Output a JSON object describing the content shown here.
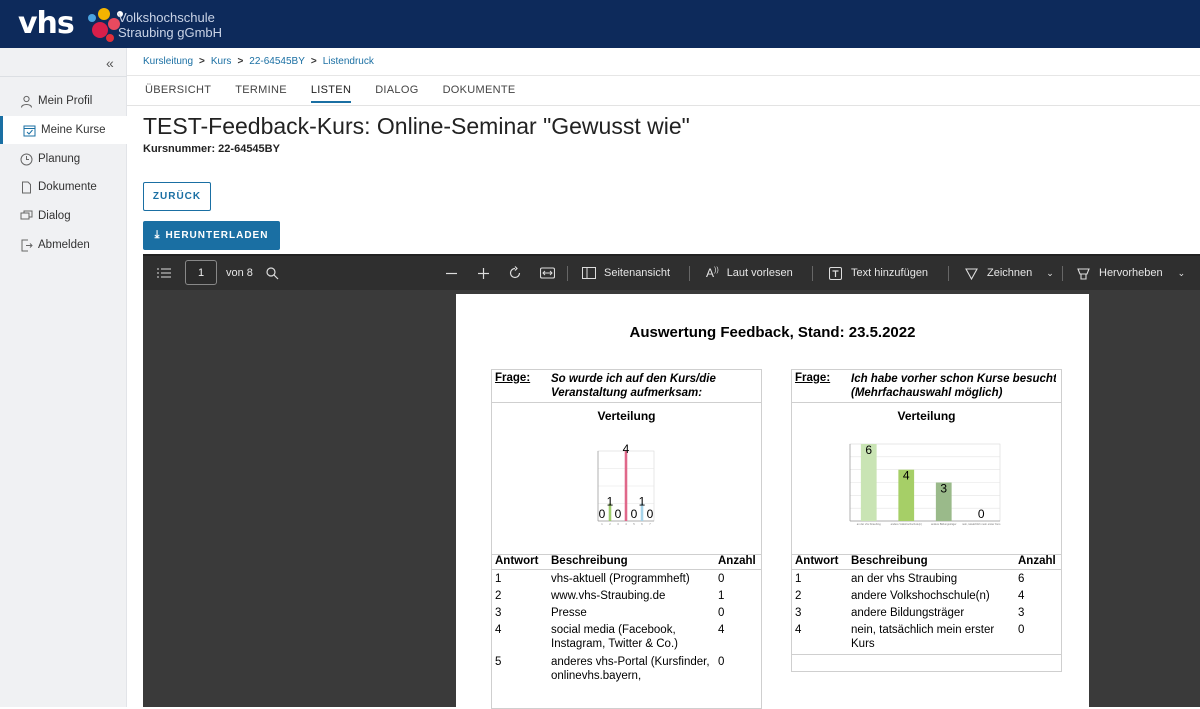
{
  "header": {
    "logo_text": "vhs",
    "brand_line1": "Volkshochschule",
    "brand_line2": "Straubing gGmbH"
  },
  "sidebar": {
    "items": [
      {
        "label": "Mein Profil",
        "icon": "person-icon"
      },
      {
        "label": "Meine Kurse",
        "icon": "calendar-check-icon",
        "active": true
      },
      {
        "label": "Planung",
        "icon": "clock-icon"
      },
      {
        "label": "Dokumente",
        "icon": "document-icon"
      },
      {
        "label": "Dialog",
        "icon": "chat-icon"
      },
      {
        "label": "Abmelden",
        "icon": "logout-icon"
      }
    ]
  },
  "breadcrumb": [
    "Kursleitung",
    "Kurs",
    "22-64545BY",
    "Listendruck"
  ],
  "tabs": [
    "ÜBERSICHT",
    "TERMINE",
    "LISTEN",
    "DIALOG",
    "DOKUMENTE"
  ],
  "page": {
    "title": "TEST-Feedback-Kurs: Online-Seminar \"Gewusst wie\"",
    "kursnummer": "Kursnummer: 22-64545BY",
    "back_label": "ZURÜCK",
    "download_label": "HERUNTERLADEN"
  },
  "viewer": {
    "page_number": "1",
    "page_count": "von 8",
    "seitenansicht": "Seitenansicht",
    "laut_vorlesen": "Laut vorlesen",
    "text_hinzufuegen": "Text hinzufügen",
    "zeichnen": "Zeichnen",
    "hervorheben": "Hervorheben"
  },
  "pdf": {
    "title": "Auswertung Feedback, Stand: 23.5.2022",
    "frage_label": "Frage:",
    "verteilung": "Verteilung",
    "col_antwort": "Antwort",
    "col_beschreibung": "Beschreibung",
    "col_anzahl": "Anzahl",
    "q1": {
      "text_line1": "So wurde ich auf den Kurs/die",
      "text_line2": "Veranstaltung aufmerksam:",
      "rows": [
        {
          "nr": "1",
          "desc": "vhs-aktuell (Programmheft)",
          "count": "0"
        },
        {
          "nr": "2",
          "desc": "www.vhs-Straubing.de",
          "count": "1"
        },
        {
          "nr": "3",
          "desc": "Presse",
          "count": "0"
        },
        {
          "nr": "4",
          "desc": "social media (Facebook, Instagram, Twitter & Co.)",
          "count": "4"
        },
        {
          "nr": "5",
          "desc": "anderes vhs-Portal (Kursfinder, onlinevhs.bayern,",
          "count": "0"
        }
      ]
    },
    "q2": {
      "text_line1": "Ich habe vorher schon Kurse besucht",
      "text_line2": "(Mehrfachauswahl möglich)",
      "rows": [
        {
          "nr": "1",
          "desc": "an der vhs Straubing",
          "count": "6"
        },
        {
          "nr": "2",
          "desc": "andere Volkshochschule(n)",
          "count": "4"
        },
        {
          "nr": "3",
          "desc": "andere Bildungsträger",
          "count": "3"
        },
        {
          "nr": "4",
          "desc": "nein, tatsächlich mein erster Kurs",
          "count": "0"
        }
      ]
    }
  },
  "chart_data": [
    {
      "type": "bar",
      "title": "Verteilung",
      "categories": [
        "1",
        "2",
        "3",
        "4",
        "5",
        "6",
        "7"
      ],
      "values": [
        0,
        1,
        0,
        4,
        0,
        1,
        0
      ],
      "colors": [
        "#9fce6e",
        "#9fce6e",
        "#c8c8c8",
        "#e0688a",
        "#c8c8c8",
        "#a7d4ea",
        "#c8c8c8"
      ],
      "ylim": [
        0,
        4
      ]
    },
    {
      "type": "bar",
      "title": "Verteilung",
      "categories": [
        "an der vhs Straubing",
        "andere Volkshochschule(n)",
        "andere Bildungsträger",
        "nein, tatsächlich mein erster Kurs"
      ],
      "values": [
        6,
        4,
        3,
        0
      ],
      "colors": [
        "#c9e4b4",
        "#a6cf67",
        "#9aba8a",
        "#c8c8c8"
      ],
      "ylim": [
        0,
        6
      ]
    }
  ]
}
